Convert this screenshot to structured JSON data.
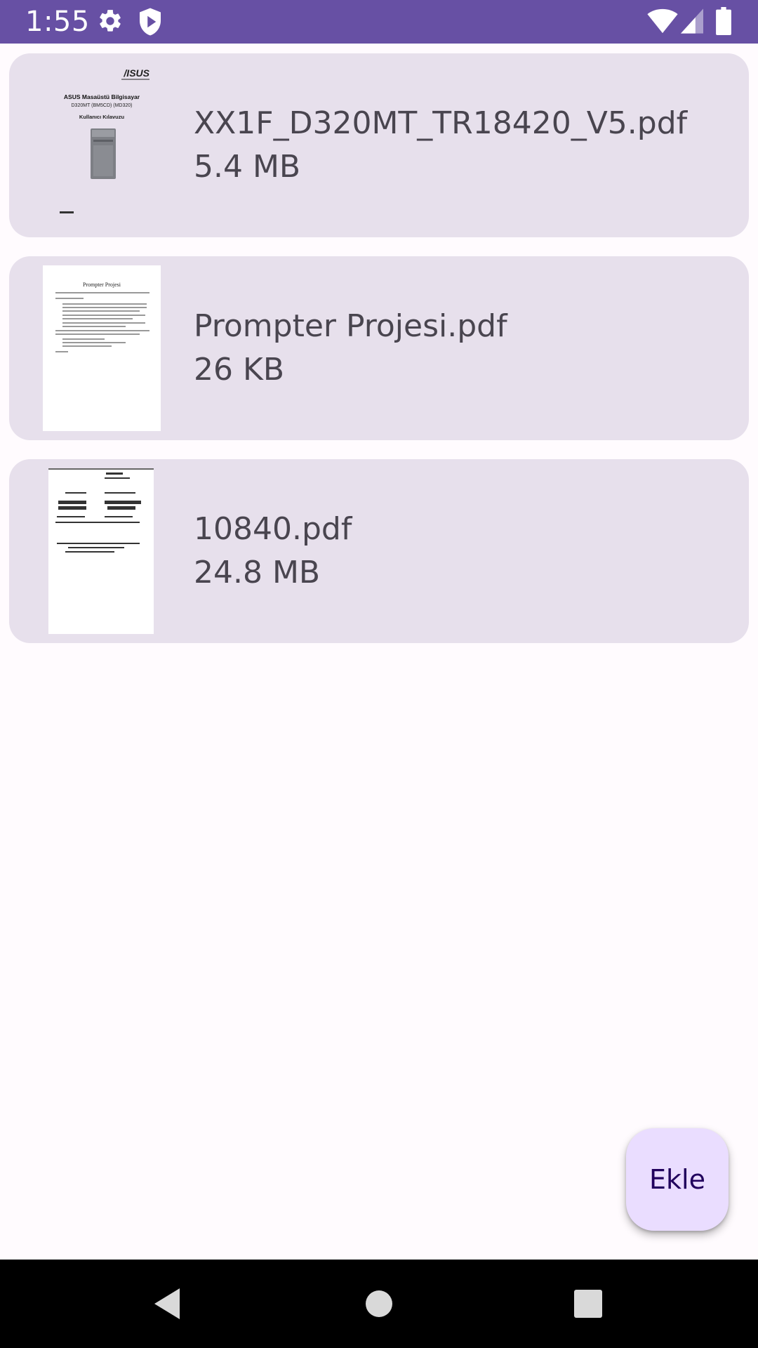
{
  "status_bar": {
    "time": "1:55",
    "icons": [
      "gear-icon",
      "shield-play-icon",
      "wifi-icon",
      "signal-icon",
      "battery-icon"
    ]
  },
  "files": [
    {
      "name": "XX1F_D320MT_TR18420_V5.pdf",
      "size": "5.4 MB",
      "thumb": {
        "brand": "/ISUS",
        "title": "ASUS Masaüstü Bilgisayar",
        "model": "D320MT (BM5CD) (MD320)",
        "subtitle": "Kullanıcı Kılavuzu"
      }
    },
    {
      "name": "Prompter Projesi.pdf",
      "size": "26 KB",
      "thumb": {
        "title": "Prompter Projesi"
      }
    },
    {
      "name": "10840.pdf",
      "size": "24.8 MB",
      "thumb": {}
    }
  ],
  "fab": {
    "label": "Ekle"
  },
  "nav": {
    "icons": [
      "back-icon",
      "home-icon",
      "recents-icon"
    ]
  },
  "colors": {
    "status_bar": "#6750a4",
    "card": "#e7e0ec",
    "fab": "#eaddff",
    "fab_text": "#21005d",
    "background": "#fffbfe"
  }
}
